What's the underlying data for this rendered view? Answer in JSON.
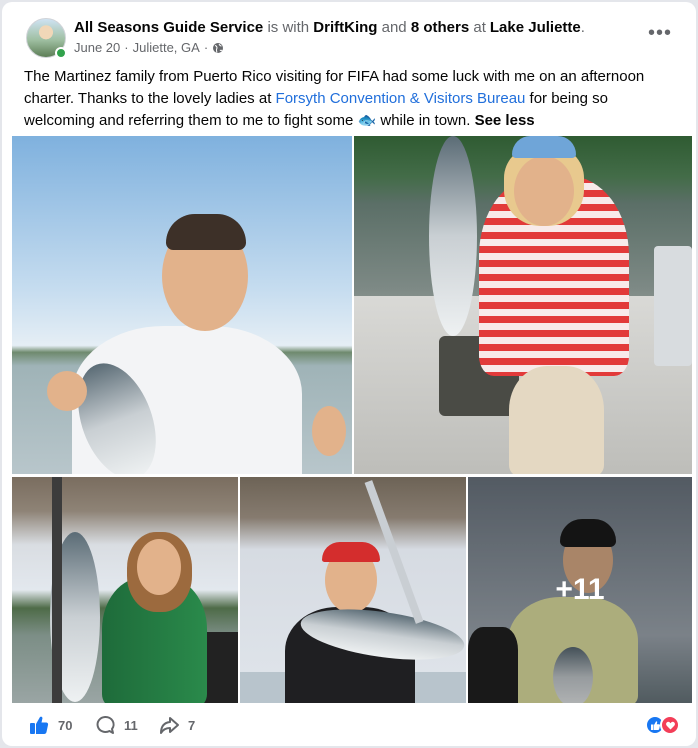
{
  "post": {
    "author": "All Seasons Guide Service",
    "with_text": "is with",
    "tagged": "DriftKing",
    "and_text": "and",
    "others": "8 others",
    "at_text": "at",
    "place": "Lake Juliette",
    "period": ".",
    "date": "June 20",
    "location": "Juliette, GA",
    "separator": "·",
    "privacy_icon": "globe-icon",
    "more_icon": "more-options-icon",
    "text_part1": "The Martinez family from Puerto Rico visiting for FIFA had some luck with me on an afternoon charter.  Thanks to the lovely ladies at ",
    "text_link": "Forsyth Convention & Visitors Bureau",
    "text_part2": " for being so welcoming and referring them to me to fight some ",
    "text_emoji": "🐟",
    "text_part3": " while in town. ",
    "see_less": "See less"
  },
  "photos": {
    "more_count": "+11",
    "items": [
      "man-holding-fish-photo",
      "woman-holding-fish-photo",
      "girl-holding-fish-photo",
      "teen-holding-fish-photo",
      "boy-holding-fish-photo"
    ]
  },
  "footer": {
    "likes": "70",
    "comments": "11",
    "shares": "7",
    "like_icon": "thumbs-up-icon",
    "comment_icon": "comment-icon",
    "share_icon": "share-icon",
    "reactions": [
      "like",
      "love"
    ]
  },
  "colors": {
    "link": "#216fdb",
    "like": "#1877f2",
    "love": "#f33e58",
    "online": "#31a24c"
  }
}
